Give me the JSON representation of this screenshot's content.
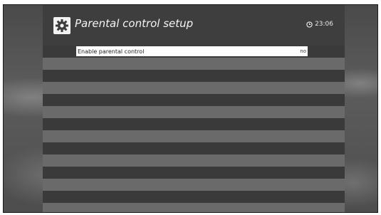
{
  "header": {
    "title": "Parental control setup",
    "time": "23:06",
    "icon": "gear-icon",
    "clock_icon": "clock-icon"
  },
  "menu": {
    "items": [
      {
        "label": "Enable parental control",
        "value": "no",
        "selected": true
      }
    ]
  },
  "colors": {
    "panel": "#3c3c3c",
    "row_light": "#6a6a6a",
    "selected": "#ffffff"
  }
}
